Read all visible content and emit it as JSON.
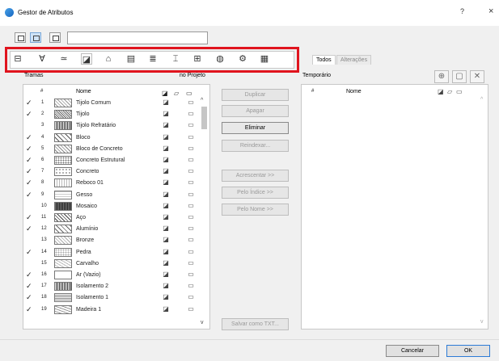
{
  "window": {
    "title": "Gestor de Atributos",
    "help_label": "?",
    "close_label": "×"
  },
  "toolbar": {
    "name_value": ""
  },
  "type_tabs": [
    {
      "icon": "composites-icon",
      "glyph": "⊟"
    },
    {
      "icon": "pens-icon",
      "glyph": "Ɐ"
    },
    {
      "icon": "line-types-icon",
      "glyph": "≃"
    },
    {
      "icon": "fills-icon",
      "glyph": "◪"
    },
    {
      "icon": "surfaces-icon",
      "glyph": "⌂"
    },
    {
      "icon": "building-materials-icon",
      "glyph": "▤"
    },
    {
      "icon": "layers-icon",
      "glyph": "≣"
    },
    {
      "icon": "profiles-icon",
      "glyph": "⌶"
    },
    {
      "icon": "zones-icon",
      "glyph": "⊞"
    },
    {
      "icon": "operations-icon",
      "glyph": "◍"
    },
    {
      "icon": "mep-systems-icon",
      "glyph": "⚙"
    },
    {
      "icon": "markup-icon",
      "glyph": "▦"
    }
  ],
  "right_tabs": {
    "all": "Todos",
    "changes": "Alterações"
  },
  "left_panel": {
    "title": "Tramas",
    "scope": "no Projeto",
    "col_num": "#",
    "col_name": "Nome"
  },
  "right_panel": {
    "title": "Temporário",
    "col_num": "#",
    "col_name": "Nome"
  },
  "fills": [
    {
      "checked": true,
      "num": "1",
      "name": "Tijolo Comum"
    },
    {
      "checked": true,
      "num": "2",
      "name": "Tijolo"
    },
    {
      "checked": false,
      "num": "3",
      "name": "Tijolo Refratário"
    },
    {
      "checked": true,
      "num": "4",
      "name": "Bloco"
    },
    {
      "checked": true,
      "num": "5",
      "name": "Bloco de Concreto"
    },
    {
      "checked": true,
      "num": "6",
      "name": "Concreto Estrutural"
    },
    {
      "checked": true,
      "num": "7",
      "name": "Concreto"
    },
    {
      "checked": true,
      "num": "8",
      "name": "Reboco 01"
    },
    {
      "checked": true,
      "num": "9",
      "name": "Gesso"
    },
    {
      "checked": false,
      "num": "10",
      "name": "Mosaico"
    },
    {
      "checked": true,
      "num": "11",
      "name": "Aço"
    },
    {
      "checked": true,
      "num": "12",
      "name": "Alumínio"
    },
    {
      "checked": false,
      "num": "13",
      "name": "Bronze"
    },
    {
      "checked": true,
      "num": "14",
      "name": "Pedra"
    },
    {
      "checked": false,
      "num": "15",
      "name": "Carvalho"
    },
    {
      "checked": true,
      "num": "16",
      "name": "Ar (Vazio)"
    },
    {
      "checked": true,
      "num": "17",
      "name": "Isolamento 2"
    },
    {
      "checked": true,
      "num": "18",
      "name": "Isolamento 1"
    },
    {
      "checked": true,
      "num": "19",
      "name": "Madeira 1"
    }
  ],
  "actions": {
    "duplicate": "Duplicar",
    "delete": "Apagar",
    "purge": "Eliminar",
    "reindex": "Reindexar...",
    "append": "Acrescentar >>",
    "by_index": "Pelo Índice >>",
    "by_name": "Pelo Nome >>",
    "save_txt": "Salvar como TXT..."
  },
  "footer": {
    "cancel": "Cancelar",
    "ok": "OK"
  },
  "colors": {
    "highlight": "#e0141e",
    "selected_view": "#cfe3f7"
  }
}
